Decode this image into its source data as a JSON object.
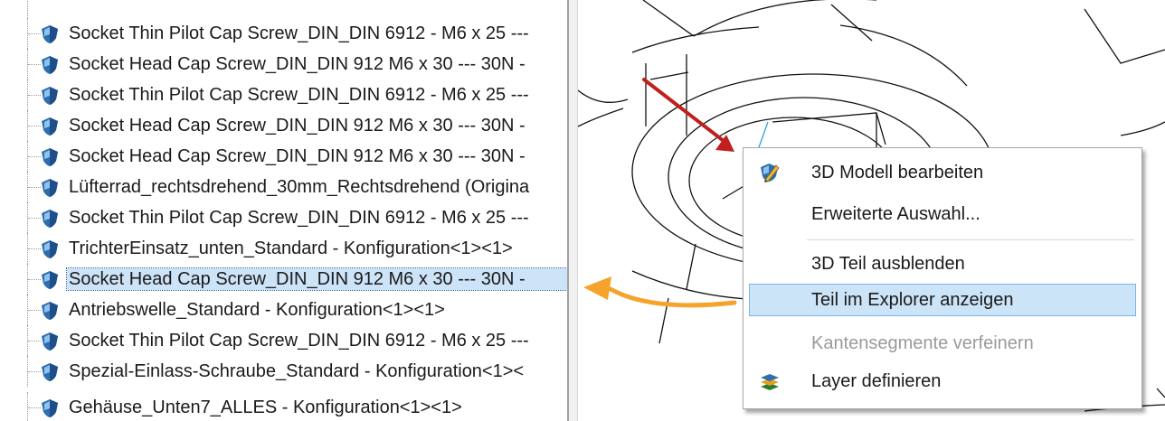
{
  "tree": {
    "items": [
      {
        "label": "Socket Thin Pilot Cap Screw_DIN_DIN 6912 - M6 x 25 ---"
      },
      {
        "label": "Socket Head Cap Screw_DIN_DIN 912 M6 x 30 --- 30N -"
      },
      {
        "label": "Socket Thin Pilot Cap Screw_DIN_DIN 6912 - M6 x 25 ---"
      },
      {
        "label": "Socket Head Cap Screw_DIN_DIN 912 M6 x 30 --- 30N -"
      },
      {
        "label": "Socket Head Cap Screw_DIN_DIN 912 M6 x 30 --- 30N -"
      },
      {
        "label": "Lüfterrad_rechtsdrehend_30mm_Rechtsdrehend (Origina"
      },
      {
        "label": "Socket Thin Pilot Cap Screw_DIN_DIN 6912 - M6 x 25 ---"
      },
      {
        "label": "TrichterEinsatz_unten_Standard - Konfiguration<1><1>"
      },
      {
        "label": "Socket Head Cap Screw_DIN_DIN 912 M6 x 30 --- 30N -",
        "selected": true
      },
      {
        "label": "Antriebswelle_Standard - Konfiguration<1><1>"
      },
      {
        "label": "Socket Thin Pilot Cap Screw_DIN_DIN 6912 - M6 x 25 ---"
      },
      {
        "label": "Spezial-Einlass-Schraube_Standard - Konfiguration<1><"
      },
      {
        "label": "Gehäuse_Unten7_ALLES - Konfiguration<1><1>"
      }
    ],
    "item_icon": "part-shield-icon",
    "part_icon_color": "#2f6fb0"
  },
  "context_menu": {
    "items": [
      {
        "label": "3D Modell bearbeiten",
        "icon": "edit-3d-model-icon"
      },
      {
        "label": "Erweiterte Auswahl..."
      },
      {
        "label": "3D Teil ausblenden"
      },
      {
        "label": "Teil im Explorer anzeigen",
        "hover": true
      },
      {
        "label": "Kantensegmente verfeinern",
        "disabled": true
      },
      {
        "label": "Layer definieren",
        "icon": "layers-icon"
      }
    ]
  },
  "colors": {
    "selection": "#cde3f7",
    "menu_hover": "#cce4f7",
    "red_arrow": "#c0201e",
    "orange_arrow": "#f5a32a"
  }
}
